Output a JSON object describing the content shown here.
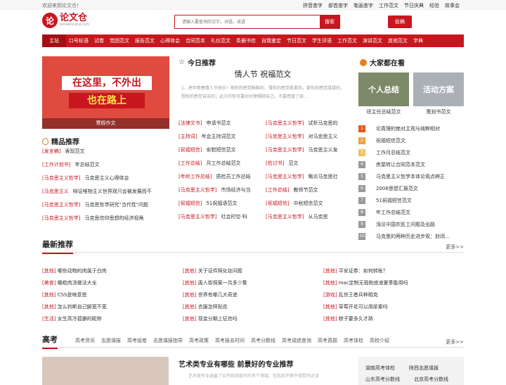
{
  "topbar": {
    "welcome": "欢迎来到论文仓！",
    "links": [
      "拼音查字",
      "部首查字",
      "笔画查字",
      "工作范文",
      "节日庆典",
      "经验",
      "故事会"
    ]
  },
  "logo": {
    "mark": "论",
    "name": "论文仓",
    "domain": "lunwencang.com"
  },
  "search": {
    "placeholder": "请输入要查询的汉字，词语，成语",
    "button": "搜索"
  },
  "submit_button": "投稿",
  "nav": [
    "主站",
    "口号标语",
    "试卷",
    "党团范文",
    "报告范文",
    "心得体会",
    "合同范本",
    "礼仪范文",
    "条据书信",
    "自我鉴定",
    "节日范文",
    "学生评语",
    "工作范文",
    "演讲范文",
    "其他范文",
    "字典"
  ],
  "banner": {
    "line1": "在这里，不外出",
    "line2": "也在路上",
    "caption": "寒假作文"
  },
  "featured": {
    "title": "精品推荐",
    "items": [
      {
        "tag": "[发言稿]",
        "text": "表现范文"
      },
      {
        "tag": "[工作计划书]",
        "text": "年总结范文"
      },
      {
        "tag": "[马克思主义哲学]",
        "text": "马克思主义心得体会"
      },
      {
        "tag": "[马克思主义",
        "text": "辩证唯物主义世界观只会被发展而不"
      },
      {
        "tag": "[马克思主义哲学]",
        "text": "马克思哲学研究\"当代性\"问题"
      },
      {
        "tag": "[马克思主义哲学]",
        "text": "马克思信仰思想的经济视角"
      }
    ]
  },
  "today": {
    "title": "今日推荐",
    "article_title": "情人节 祝福范文",
    "article_body": "1、虎年新春情人节快乐！啪你的感觉酥酥的，薄你的感觉柔柔的，爱你的感觉甜甜的，想你的感觉苦苦的；远方的你可要好好傍照顾自己，不要感冒了哀...",
    "left": [
      {
        "tag": "[法律文书]",
        "text": "申请书范文"
      },
      {
        "tag": "[主持词]",
        "text": "年会主持词范文"
      },
      {
        "tag": "[祝福短信]",
        "text": "安慰短信范文"
      },
      {
        "tag": "[工作总结]",
        "text": "月工作总结范文"
      },
      {
        "tag": "[年终工作总结]",
        "text": "质检员工作总结"
      },
      {
        "tag": "[马克思主义哲学]",
        "text": "市场经济与当"
      },
      {
        "tag": "[祝福短信]",
        "text": "51祝福语范文"
      },
      {
        "tag": "[马克思主义哲学]",
        "text": "社会时空·科"
      }
    ],
    "right": [
      {
        "tag": "[马克思主义哲学]",
        "text": "试析马克思的"
      },
      {
        "tag": "[马克思主义哲学]",
        "text": "对马克思主义"
      },
      {
        "tag": "[马克思主义哲学]",
        "text": "马克思主义发"
      },
      {
        "tag": "[检讨书]",
        "text": "范文"
      },
      {
        "tag": "[马克思主义哲学]",
        "text": "略论马克思社"
      },
      {
        "tag": "[工作总结]",
        "text": "教师节范文"
      },
      {
        "tag": "[祝福短信]",
        "text": "中秋短信范文"
      },
      {
        "tag": "[马克思主义哲学]",
        "text": "从马克思"
      }
    ]
  },
  "popular": {
    "title": "大家都在看",
    "thumbs": [
      {
        "img_text": "个人总结",
        "caption": "班主任总结范文"
      },
      {
        "img_text": "活动方案",
        "caption": "策划书范文"
      }
    ],
    "ranking": [
      "论真理的绝对主观与纯粹相对",
      "祝福短信范文",
      "工作月总结范文",
      "房屋转让合同范本范文",
      "马克思主义哲学本体论观点辨正",
      "2008思想汇报范文",
      "51祝福短信范文",
      "年工作总结范文",
      "浅议中国农民工问题及出路",
      "马克思的两种历史进步观：封闭..."
    ],
    "rank_numbers": [
      "1",
      "2",
      "3",
      "4",
      "5",
      "6",
      "7",
      "8",
      "9",
      "10"
    ]
  },
  "latest": {
    "title": "最新推荐",
    "more": "更多>>",
    "columns": [
      [
        {
          "tag": "[其他]",
          "text": "哪些动物的肉属于白肉"
        },
        {
          "tag": "[美食]",
          "text": "橄榄肉汤做法大全"
        },
        {
          "tag": "[其他]",
          "text": "CSS是啥意思"
        },
        {
          "tag": "[其他]",
          "text": "怎么判断自己脚宽不宽"
        },
        {
          "tag": "[生活]",
          "text": "女生高冷孤僻的昵称"
        }
      ],
      [
        {
          "tag": "[其他]",
          "text": "关于证件照化妆问题"
        },
        {
          "tag": "[其他]",
          "text": "唐人街探案一共多少集"
        },
        {
          "tag": "[其他]",
          "text": "世界有哪几大奇迹"
        },
        {
          "tag": "[其他]",
          "text": "衣服怎样贴花"
        },
        {
          "tag": "[其他]",
          "text": "现金分期上征信吗"
        }
      ],
      [
        {
          "tag": "[其他]",
          "text": "平安证券：如何转账？"
        },
        {
          "tag": "[其他]",
          "text": "mac定制无瑕粉底液夏季能用吗"
        },
        {
          "tag": "[游戏]",
          "text": "乱世王者兵种相克"
        },
        {
          "tag": "[其他]",
          "text": "草莓开花可以用尿素吗"
        },
        {
          "tag": "[其他]",
          "text": "粽子要多久才熟"
        }
      ]
    ]
  },
  "gaokao": {
    "title": "高考",
    "more": "更多>>",
    "tabs": [
      "高考资讯",
      "志愿填报",
      "高考组卷",
      "志愿填报指导",
      "高考政策",
      "高考报名时间",
      "高考分数线",
      "高考成绩查询",
      "高考真题",
      "高考体检",
      "高校介绍"
    ],
    "feature_title": "艺术类专业有哪些 前景好的专业推荐",
    "feature_text": "艺术类专业涵盖了从传统到现代的多个领域，包括但不限于视觉传达设",
    "box_links": [
      [
        "湖南高考体检",
        "陕西志愿填报"
      ],
      [
        "山东高考分数线",
        "北京高考分数线"
      ]
    ]
  },
  "colors": {
    "brand": "#c8161e"
  }
}
